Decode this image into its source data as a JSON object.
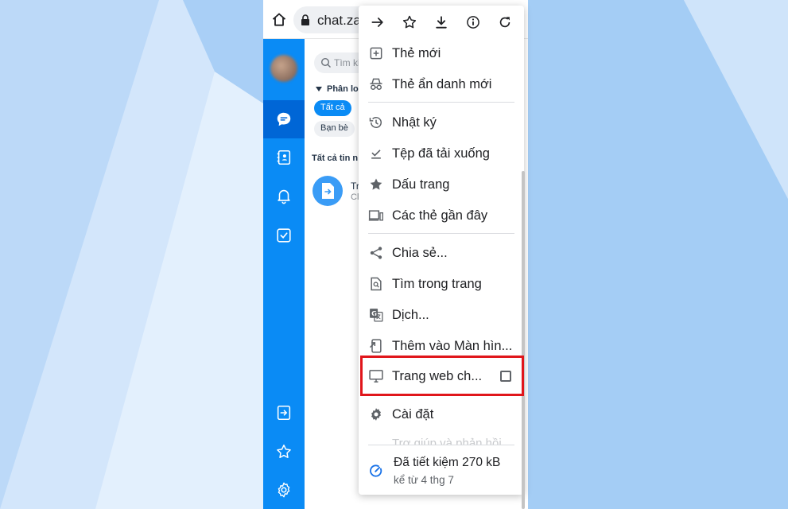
{
  "browser": {
    "url": "chat.za",
    "toolbar": [
      "forward-icon",
      "bookmark-star-icon",
      "download-icon",
      "info-icon",
      "reload-icon"
    ]
  },
  "app": {
    "search_placeholder": "Tìm ki",
    "filter_label": "Phân loạ",
    "chips": {
      "all": "Tất cả",
      "friends": "Bạn bè"
    },
    "section_title": "Tất cả tin n",
    "conversation": {
      "title": "Tr",
      "subtitle": "Cl"
    },
    "sidebar_icons": [
      "chat-icon",
      "contacts-icon",
      "bell-icon",
      "todo-icon",
      "file-transfer-icon",
      "star-icon",
      "settings-icon"
    ]
  },
  "menu": {
    "items": [
      {
        "label": "Thẻ mới",
        "icon": "new-tab-icon"
      },
      {
        "label": "Thẻ ẩn danh mới",
        "icon": "incognito-icon"
      },
      {
        "label": "Nhật ký",
        "icon": "history-icon"
      },
      {
        "label": "Tệp đã tải xuống",
        "icon": "downloads-icon"
      },
      {
        "label": "Dấu trang",
        "icon": "bookmarks-icon"
      },
      {
        "label": "Các thẻ gần đây",
        "icon": "recent-tabs-icon"
      },
      {
        "label": "Chia sẻ...",
        "icon": "share-icon"
      },
      {
        "label": "Tìm trong trang",
        "icon": "find-in-page-icon"
      },
      {
        "label": "Dịch...",
        "icon": "translate-icon"
      },
      {
        "label": "Thêm vào Màn hìn...",
        "icon": "add-to-home-icon"
      },
      {
        "label": "Trang web ch...",
        "icon": "desktop-site-icon"
      },
      {
        "label": "Cài đặt",
        "icon": "settings-icon"
      }
    ],
    "faded_item": "Trợ giúp và phản hồi",
    "savings": {
      "main": "Đã tiết kiệm 270 kB",
      "sub": "kể từ 4 thg 7"
    },
    "highlight_color": "#e0161b"
  }
}
